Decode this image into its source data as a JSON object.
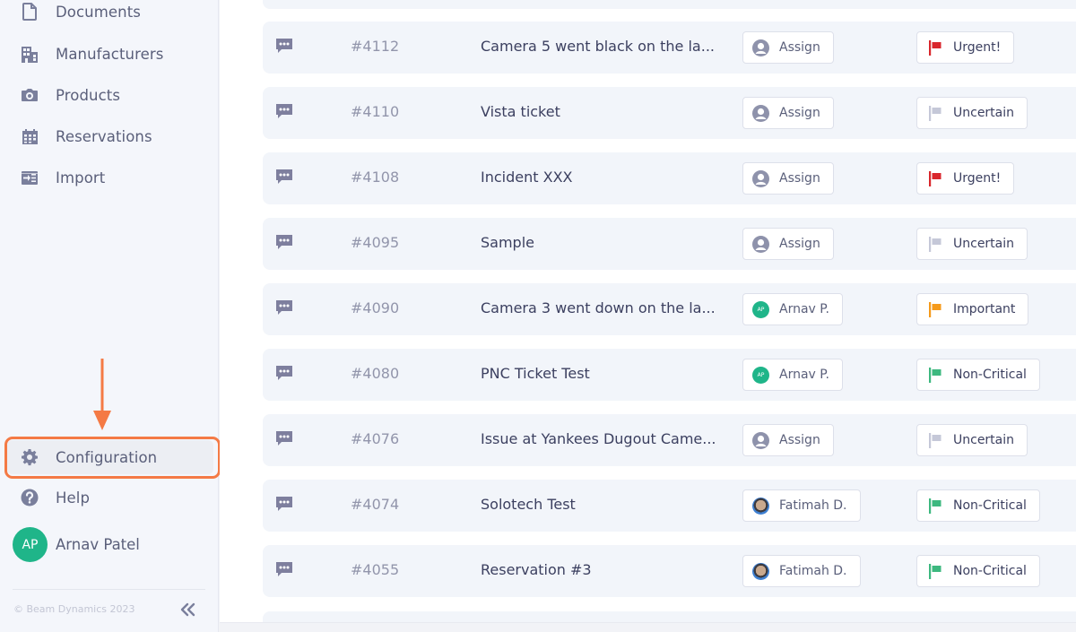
{
  "sidebar": {
    "items": [
      {
        "label": "Documents",
        "icon": "document-icon"
      },
      {
        "label": "Manufacturers",
        "icon": "building-icon"
      },
      {
        "label": "Products",
        "icon": "camera-icon"
      },
      {
        "label": "Reservations",
        "icon": "calendar-icon"
      },
      {
        "label": "Import",
        "icon": "import-icon"
      }
    ],
    "configuration": {
      "label": "Configuration",
      "icon": "gear-icon"
    },
    "help": {
      "label": "Help",
      "icon": "question-icon"
    },
    "user": {
      "initials": "AP",
      "name": "Arnav Patel",
      "avatar_color": "#1fb589"
    },
    "copyright": "© Beam Dynamics 2023",
    "collapse_icon": "double-chevron-left-icon"
  },
  "annotation": {
    "color": "#f47a45",
    "target": "Configuration"
  },
  "tickets": [
    {
      "id": "#4112",
      "title": "Camera 5 went black on the la...",
      "assignee": {
        "type": "none",
        "label": "Assign"
      },
      "priority": {
        "label": "Urgent!",
        "color": "#d9262c"
      }
    },
    {
      "id": "#4110",
      "title": "Vista ticket",
      "assignee": {
        "type": "none",
        "label": "Assign"
      },
      "priority": {
        "label": "Uncertain",
        "color": "#c5c8d8"
      }
    },
    {
      "id": "#4108",
      "title": "Incident XXX",
      "assignee": {
        "type": "none",
        "label": "Assign"
      },
      "priority": {
        "label": "Urgent!",
        "color": "#d9262c"
      }
    },
    {
      "id": "#4095",
      "title": "Sample",
      "assignee": {
        "type": "none",
        "label": "Assign"
      },
      "priority": {
        "label": "Uncertain",
        "color": "#c5c8d8"
      }
    },
    {
      "id": "#4090",
      "title": "Camera 3 went down on the la...",
      "assignee": {
        "type": "initials",
        "initials": "AP",
        "label": "Arnav P."
      },
      "priority": {
        "label": "Important",
        "color": "#f59a1b"
      }
    },
    {
      "id": "#4080",
      "title": "PNC Ticket Test",
      "assignee": {
        "type": "initials",
        "initials": "AP",
        "label": "Arnav P."
      },
      "priority": {
        "label": "Non-Critical",
        "color": "#3db87f"
      }
    },
    {
      "id": "#4076",
      "title": "Issue at Yankees Dugout Came...",
      "assignee": {
        "type": "none",
        "label": "Assign"
      },
      "priority": {
        "label": "Uncertain",
        "color": "#c5c8d8"
      }
    },
    {
      "id": "#4074",
      "title": "Solotech Test",
      "assignee": {
        "type": "photo",
        "label": "Fatimah D."
      },
      "priority": {
        "label": "Non-Critical",
        "color": "#3db87f"
      }
    },
    {
      "id": "#4055",
      "title": "Reservation #3",
      "assignee": {
        "type": "photo",
        "label": "Fatimah D."
      },
      "priority": {
        "label": "Non-Critical",
        "color": "#3db87f"
      }
    }
  ]
}
